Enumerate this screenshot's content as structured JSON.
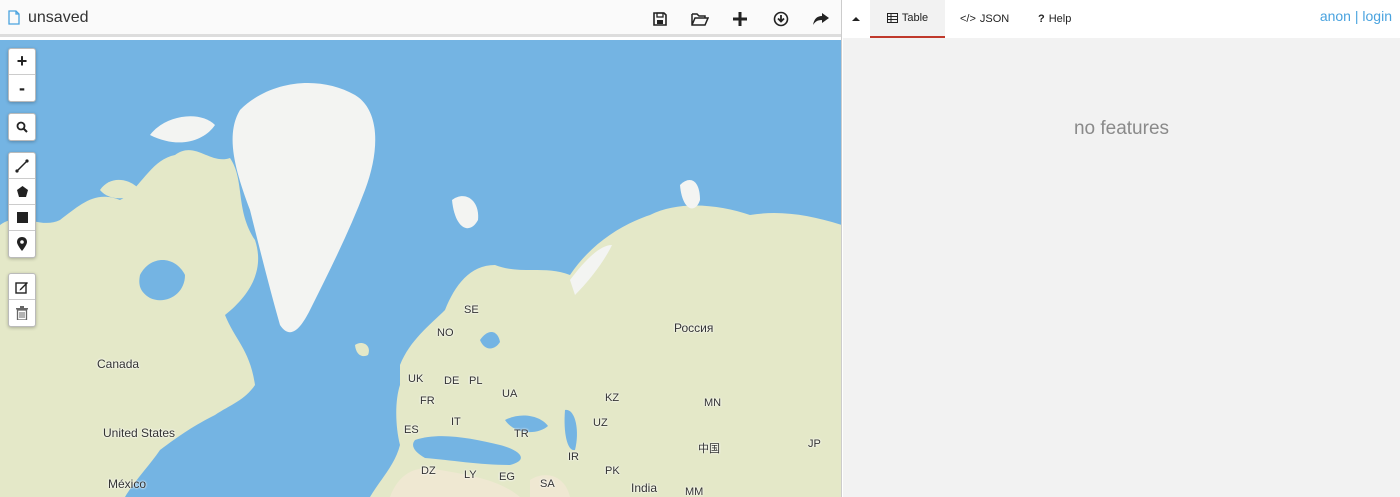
{
  "document": {
    "title": "unsaved"
  },
  "toolbar": {
    "icons": [
      "save-icon",
      "open-folder-icon",
      "plus-icon",
      "download-icon",
      "share-icon"
    ]
  },
  "map_controls": {
    "zoom_in": "+",
    "zoom_out": "-"
  },
  "map_labels": {
    "canada": "Canada",
    "united_states": "United States",
    "mexico": "México",
    "se": "SE",
    "no": "NO",
    "uk": "UK",
    "de": "DE",
    "pl": "PL",
    "ua": "UA",
    "fr": "FR",
    "es": "ES",
    "it": "IT",
    "tr": "TR",
    "dz": "DZ",
    "ly": "LY",
    "eg": "EG",
    "sa": "SA",
    "ir": "IR",
    "pk": "PK",
    "india": "India",
    "mm": "MM",
    "kz": "KZ",
    "uz": "UZ",
    "mn": "MN",
    "china": "中国",
    "jp": "JP",
    "russia": "Россия"
  },
  "tabs": {
    "table": "Table",
    "json": "JSON",
    "help": "Help"
  },
  "user": {
    "anon": "anon",
    "separator": "|",
    "login": "login"
  },
  "table_panel": {
    "empty_message": "no features"
  },
  "colors": {
    "water": "#74b4e3",
    "land": "#e4e8c8",
    "ice": "#f3f4f2",
    "accent": "#c0392b",
    "link": "#4aa3df"
  }
}
